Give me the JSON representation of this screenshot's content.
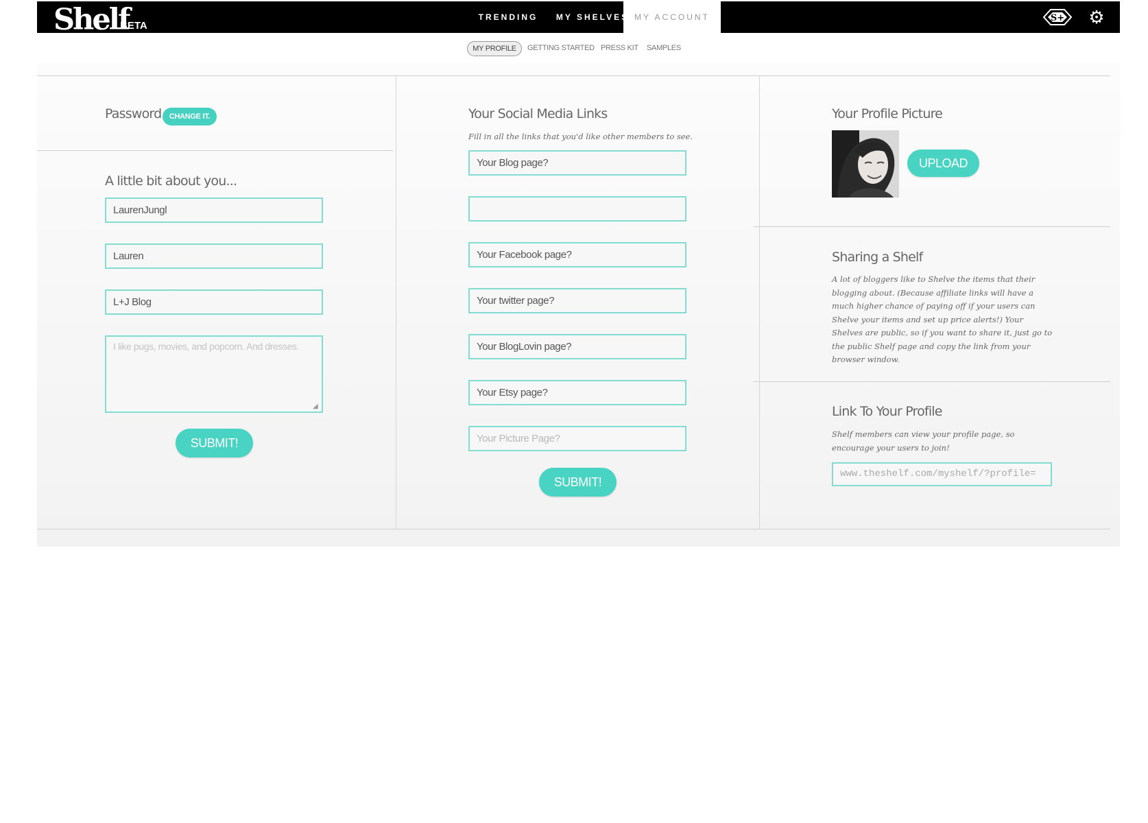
{
  "header": {
    "logo": "Shelf",
    "logo_badge": "BETA",
    "nav": [
      "TRENDING",
      "MY SHELVES",
      "MY ACCOUNT"
    ],
    "icons": [
      "shelf-plus-icon",
      "gear-icon"
    ],
    "badge_label": "S+"
  },
  "subnav": [
    "MY PROFILE",
    "GETTING STARTED",
    "PRESS KIT",
    "SAMPLES"
  ],
  "password": {
    "title": "Password",
    "change_label": "CHANGE IT."
  },
  "about": {
    "title": "A little bit about you...",
    "fields": [
      "LaurenJungl",
      "Lauren",
      "L+J Blog"
    ],
    "bio_placeholder": "I like pugs, movies, and popcorn. And dresses.",
    "submit_label": "SUBMIT!"
  },
  "social": {
    "title": "Your Social Media Links",
    "subtitle": "Fill in all the links that you'd like other members to see.",
    "fields": [
      {
        "value": "Your Blog page?",
        "placeholder": false
      },
      {
        "value": "",
        "placeholder": false
      },
      {
        "value": "Your Facebook page?",
        "placeholder": false
      },
      {
        "value": "Your twitter page?",
        "placeholder": false
      },
      {
        "value": "Your BlogLovin page?",
        "placeholder": false
      },
      {
        "value": "Your Etsy page?",
        "placeholder": false
      },
      {
        "value": "Your Picture Page?",
        "placeholder": true
      }
    ],
    "submit_label": "SUBMIT!"
  },
  "profile_picture": {
    "title": "Your Profile Picture",
    "upload_label": "UPLOAD"
  },
  "sharing": {
    "title": "Sharing a Shelf",
    "body": "A lot of bloggers like to Shelve the items that their blogging about. (Because affiliate links will have a much higher chance of paying off if your users can Shelve your items and set up price alerts!) Your Shelves are public, so if you want to share it, just go to the public Shelf page and copy the link from your browser window."
  },
  "link": {
    "title": "Link To Your Profile",
    "body": "Shelf members can view your profile page, so encourage your users to join!",
    "url": "www.theshelf.com/myshelf/?profile="
  },
  "colors": {
    "accent": "#46d0c0",
    "field_border": "#82dccf",
    "topbar": "#000000"
  }
}
